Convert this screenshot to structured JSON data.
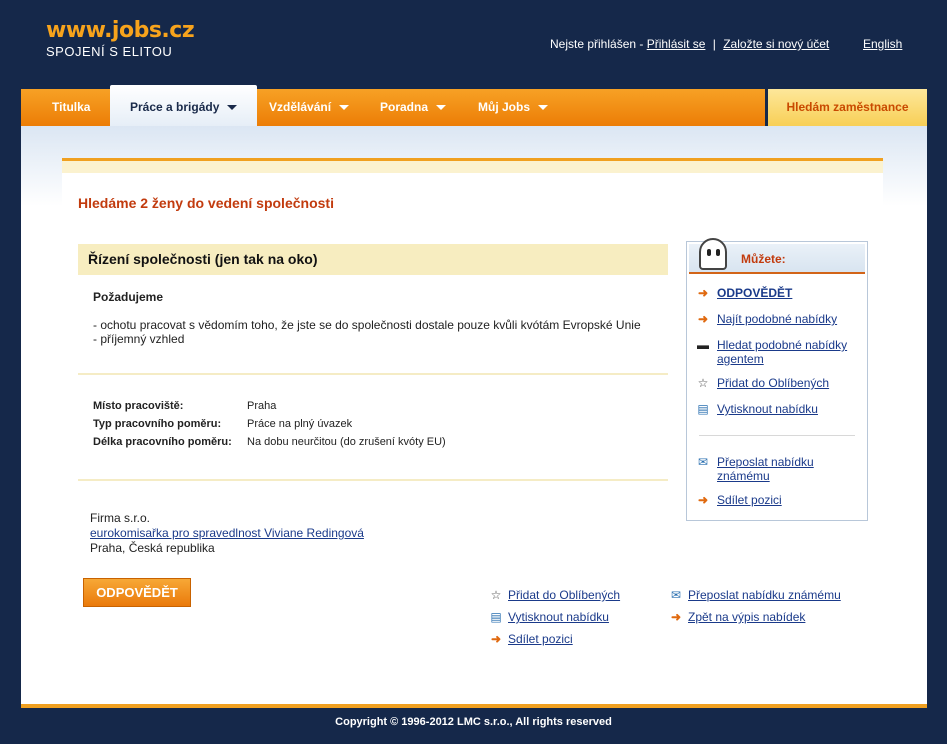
{
  "header": {
    "logo_domain": "www.jobs.cz",
    "logo_tagline": "SPOJENÍ S ELITOU",
    "status_text": "Nejste přihlášen -",
    "login_link": "Přihlásit se",
    "separator": "|",
    "register_link": "Založte si nový účet",
    "language_link": "English"
  },
  "nav": {
    "items": [
      {
        "label": "Titulka"
      },
      {
        "label": "Práce a brigády"
      },
      {
        "label": "Vzdělávání"
      },
      {
        "label": "Poradna"
      },
      {
        "label": "Můj Jobs"
      }
    ],
    "employer_label": "Hledám zaměstnance"
  },
  "job": {
    "title": "Hledáme 2 ženy do vedení společnosti",
    "section_title": "Řízení společnosti (jen tak na oko)",
    "requirements_title": "Požadujeme",
    "requirements": [
      "- ochotu pracovat s vědomím toho, že jste se do společnosti dostale pouze kvůli kvótám Evropské Unie",
      "- příjemný vzhled"
    ],
    "details": [
      {
        "key": "Místo pracoviště:",
        "value": "Praha"
      },
      {
        "key": "Typ pracovního poměru:",
        "value": "Práce na plný úvazek"
      },
      {
        "key": "Délka pracovního poměru:",
        "value": "Na dobu neurčitou (do zrušení kvóty EU)"
      }
    ],
    "company_name": "Firma s.r.o.",
    "company_contact": "eurokomisařka pro spravedlnost Viviane Redingová",
    "company_location": "Praha, Česká republika",
    "apply_button": "ODPOVĚDĚT"
  },
  "sidebar": {
    "title": "Můžete:",
    "links": [
      {
        "label": "ODPOVĚDĚT",
        "icon": "arrow-icon"
      },
      {
        "label": "Najít podobné nabídky",
        "icon": "arrow-icon"
      },
      {
        "label": "Hledat podobné nabídky",
        "label2": "agentem",
        "icon": "agent-hat-icon"
      },
      {
        "label": "Přidat do Oblíbených",
        "icon": "star-icon"
      },
      {
        "label": "Vytisknout nabídku",
        "icon": "printer-icon"
      },
      {
        "label": "Přeposlat nabídku",
        "label2": "známému",
        "icon": "mail-icon"
      },
      {
        "label": "Sdílet pozici",
        "icon": "arrow-icon"
      }
    ]
  },
  "bottom_links": {
    "favorites": "Přidat do Oblíbených",
    "print": "Vytisknout nabídku",
    "share": "Sdílet pozici",
    "forward": "Přeposlat nabídku známému",
    "back": "Zpět na výpis nabídek"
  },
  "footer": {
    "copyright": "Copyright © 1996-2012  LMC s.r.o., All rights reserved"
  },
  "colors": {
    "background": "#15284a",
    "nav_orange": "#f39018",
    "title_red": "#c23b0e",
    "highlight_yellow": "#f7edc0"
  }
}
